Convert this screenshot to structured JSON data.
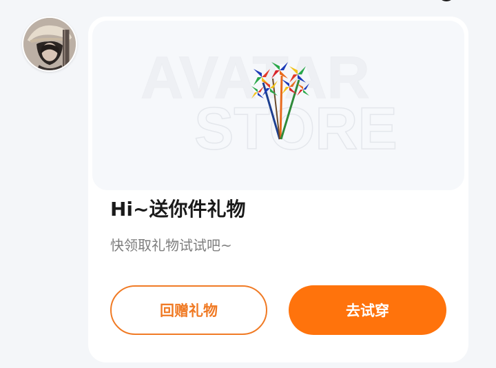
{
  "message": {
    "title": "Hi~送你件礼物",
    "subtitle": "快领取礼物试试吧~"
  },
  "banner": {
    "watermark_line1": "AVATAR",
    "watermark_line2": "STORE",
    "item_icon": "pinwheel-bouquet-icon"
  },
  "buttons": {
    "gift_back_label": "回赠礼物",
    "try_on_label": "去试穿"
  },
  "colors": {
    "accent": "#ff730c",
    "outline_accent": "#f07a24",
    "page_background": "#f4f6f9",
    "card_background": "#ffffff",
    "banner_background": "#f6f8fb"
  }
}
